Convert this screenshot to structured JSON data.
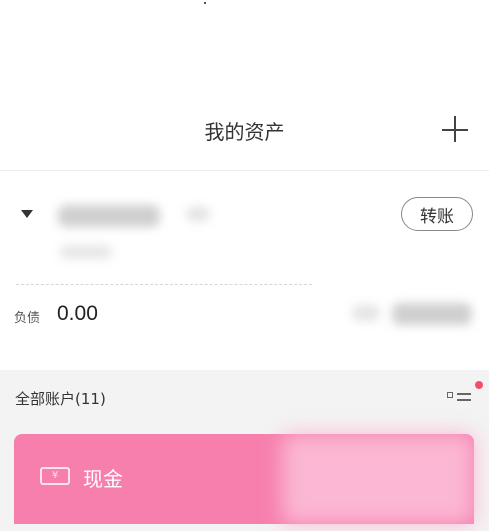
{
  "header": {
    "title": "我的资产"
  },
  "summary": {
    "transfer_label": "转账",
    "debt_label": "负债",
    "debt_value": "0.00"
  },
  "accounts": {
    "header_label": "全部账户(11)",
    "items": [
      {
        "name": "现金",
        "icon": "cash-icon",
        "color": "#f67fae"
      }
    ]
  },
  "colors": {
    "accent": "#f67fae",
    "badge": "#f24e6a",
    "list_background": "#f3f3f3"
  }
}
